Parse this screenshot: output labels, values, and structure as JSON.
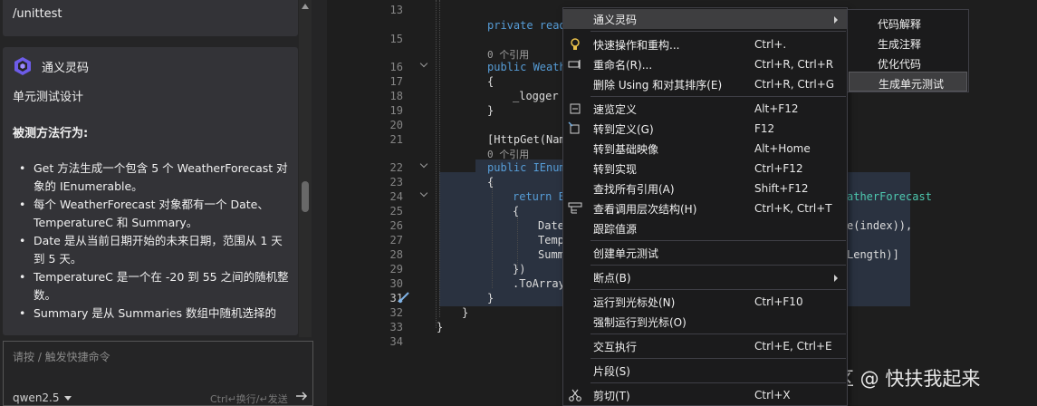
{
  "chat": {
    "slash_command": "/unittest",
    "agent_name": "通义灵码",
    "heading": "单元测试设计",
    "subheading": "被测方法行为:",
    "bullets": [
      "Get 方法生成一个包含 5 个 WeatherForecast 对象的 IEnumerable。",
      "每个 WeatherForecast 对象都有一个 Date、TemperatureC 和 Summary。",
      "Date 是从当前日期开始的未来日期，范围从 1 天到 5 天。",
      "TemperatureC 是一个在 -20 到 55 之间的随机整数。",
      "Summary 是从 Summaries 数组中随机选择的"
    ],
    "input_placeholder": "请按 / 触发快捷命令",
    "model": "qwen2.5",
    "send_hint": "Ctrl↵换行/↵发送"
  },
  "editor": {
    "line_numbers": [
      "13",
      "15",
      "16",
      "17",
      "18",
      "19",
      "20",
      "21",
      "22",
      "23",
      "24",
      "25",
      "26",
      "27",
      "28",
      "29",
      "30",
      "31",
      "32",
      "33",
      "34"
    ],
    "code": {
      "l13": "private read",
      "l15_ref": "0 个引用",
      "l16": "public Weath",
      "l17": "{",
      "l18": "_logger",
      "l19": "}",
      "l21": "[HttpGet(Nam",
      "l21_ref": "0 个引用",
      "l22": "public IEnum",
      "l23": "{",
      "l24a": "return E",
      "l24b": "atherForecast",
      "l25": "{",
      "l26a": "Date",
      "l26b": "e(index)),",
      "l27": "Temp",
      "l28a": "Summ",
      "l28b": "Length)]",
      "l29": "})",
      "l30": ".ToArray",
      "l31": "}",
      "l32": "}",
      "l33": "}"
    }
  },
  "context_menu": {
    "items": [
      {
        "label": "通义灵码",
        "shortcut": ""
      },
      {
        "label": "快速操作和重构...",
        "shortcut": "Ctrl+."
      },
      {
        "label": "重命名(R)...",
        "shortcut": "Ctrl+R, Ctrl+R"
      },
      {
        "label": "删除 Using 和对其排序(E)",
        "shortcut": "Ctrl+R, Ctrl+G"
      },
      {
        "label": "速览定义",
        "shortcut": "Alt+F12"
      },
      {
        "label": "转到定义(G)",
        "shortcut": "F12"
      },
      {
        "label": "转到基础映像",
        "shortcut": "Alt+Home"
      },
      {
        "label": "转到实现",
        "shortcut": "Ctrl+F12"
      },
      {
        "label": "查找所有引用(A)",
        "shortcut": "Shift+F12"
      },
      {
        "label": "查看调用层次结构(H)",
        "shortcut": "Ctrl+K, Ctrl+T"
      },
      {
        "label": "跟踪值源",
        "shortcut": ""
      },
      {
        "label": "创建单元测试",
        "shortcut": ""
      },
      {
        "label": "断点(B)",
        "shortcut": ""
      },
      {
        "label": "运行到光标处(N)",
        "shortcut": "Ctrl+F10"
      },
      {
        "label": "强制运行到光标(O)",
        "shortcut": ""
      },
      {
        "label": "交互执行",
        "shortcut": "Ctrl+E, Ctrl+E"
      },
      {
        "label": "片段(S)",
        "shortcut": ""
      },
      {
        "label": "剪切(T)",
        "shortcut": "Ctrl+X"
      }
    ]
  },
  "sub_menu": {
    "items": [
      "代码解释",
      "生成注释",
      "优化代码",
      "生成单元测试"
    ]
  },
  "watermark": "掘金技术社区 @ 快扶我起来"
}
